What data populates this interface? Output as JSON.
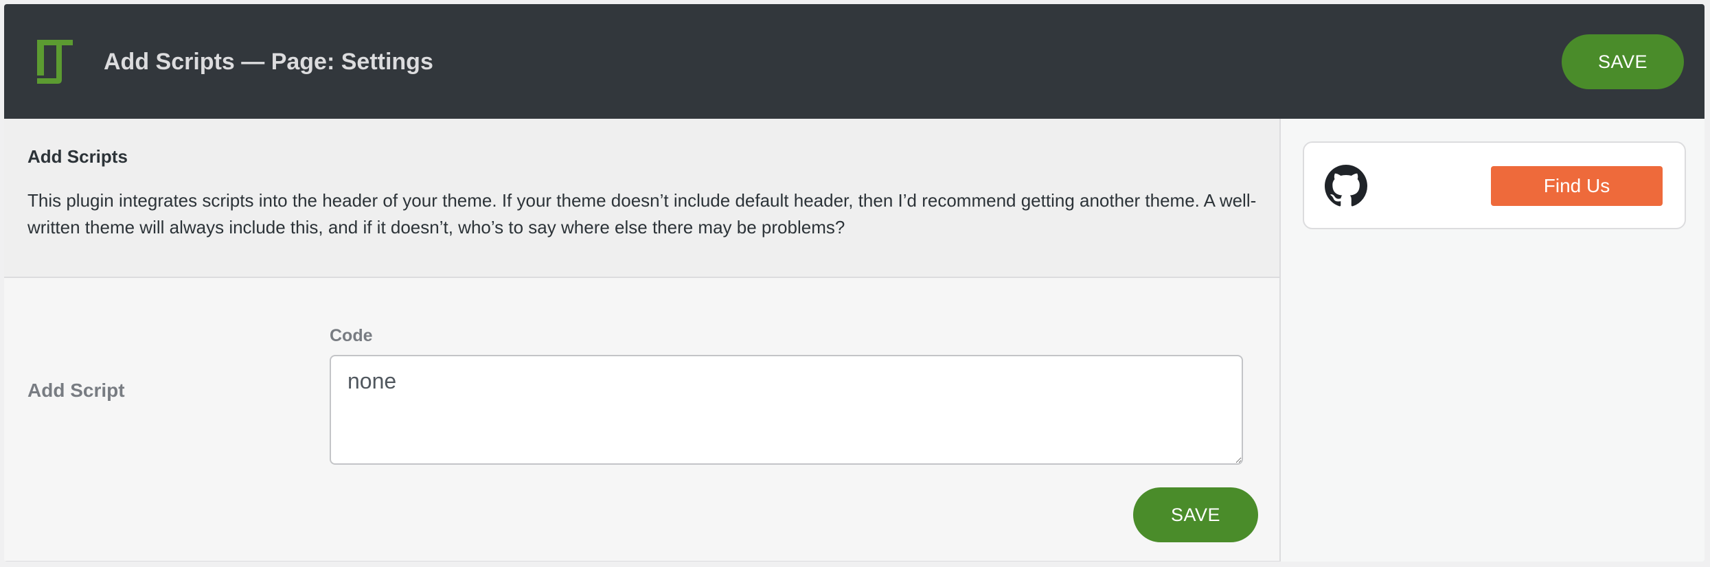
{
  "header": {
    "title": "Add Scripts — Page: Settings",
    "save_label": "SAVE",
    "logo_icon": "add-scripts-logo-icon"
  },
  "intro": {
    "heading": "Add Scripts",
    "text": "This plugin integrates scripts into the header of your theme. If your theme doesn’t include default header, then I’d recommend getting another theme. A well-written theme will always include this, and if it doesn’t, who’s to say where else there may be problems?"
  },
  "form": {
    "row_label": "Add Script",
    "code_label": "Code",
    "code_value": "none",
    "save_label": "SAVE"
  },
  "sidebar": {
    "icon": "github-icon",
    "find_us_label": "Find Us"
  },
  "colors": {
    "header_bg": "#32373c",
    "accent_green": "#4a8c2a",
    "find_us_orange": "#ee6a3b"
  }
}
